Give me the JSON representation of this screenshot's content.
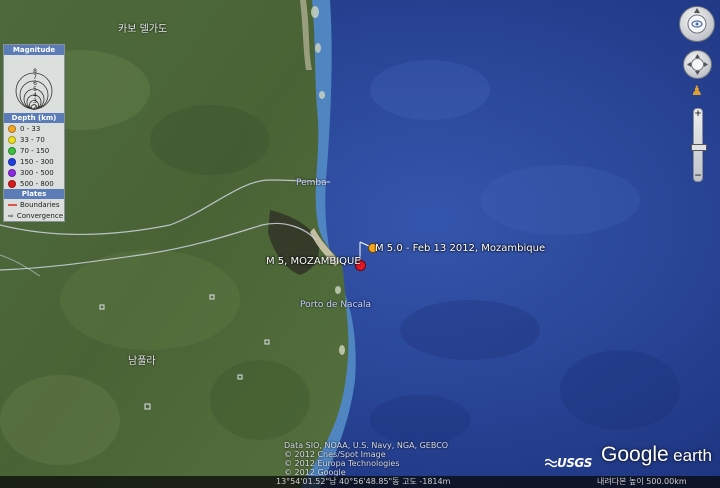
{
  "map": {
    "place_labels": {
      "cabo_delgado": "카보 델가도",
      "nampula": "남풀라",
      "city_north": "Pemba",
      "city_south": "Porto de Nacala"
    },
    "earthquakes": [
      {
        "label": "M 5.0 - Feb 13 2012, Mozambique",
        "magnitude": 5.0,
        "color": "#f5a623"
      },
      {
        "label": "M 5, MOZAMBIQUE",
        "magnitude": 5,
        "color": "#e0192a"
      }
    ]
  },
  "legend": {
    "magnitude_title": "Magnitude",
    "magnitude_scale": [
      "8",
      "7",
      "6",
      "5",
      "4",
      "3",
      "2"
    ],
    "depth_title": "Depth (km)",
    "depth_rows": [
      {
        "label": "0 - 33",
        "color": "#f5a623"
      },
      {
        "label": "33 - 70",
        "color": "#f0e020"
      },
      {
        "label": "70 - 150",
        "color": "#3cc13c"
      },
      {
        "label": "150 - 300",
        "color": "#1f3fe0"
      },
      {
        "label": "300 - 500",
        "color": "#8a2be2"
      },
      {
        "label": "500 - 800",
        "color": "#d81a1a"
      }
    ],
    "plates_title": "Plates",
    "plates_rows": [
      {
        "label": "Boundaries",
        "icon": "boundary-line"
      },
      {
        "label": "Convergence",
        "icon": "convergence-arrow"
      }
    ]
  },
  "controls": {
    "look_icon": "compass-look-icon",
    "move_icon": "move-pan-icon",
    "pegman_icon": "street-view-pegman-icon",
    "zoom_in": "+",
    "zoom_out": "−",
    "zoom_level": 0.55
  },
  "attribution": [
    "Data SIO, NOAA, U.S. Navy, NGA, GEBCO",
    "© 2012 Cnes/Spot Image",
    "© 2012 Europa Technologies",
    "© 2012 Google"
  ],
  "branding": {
    "usgs": "USGS",
    "google": "Google",
    "earth": "earth"
  },
  "statusbar": {
    "coordinates": "13°54'01.52\"남  40°56'48.85\"동  고도 -1814m",
    "eye_altitude": "내려다본 높이  500.00km"
  }
}
